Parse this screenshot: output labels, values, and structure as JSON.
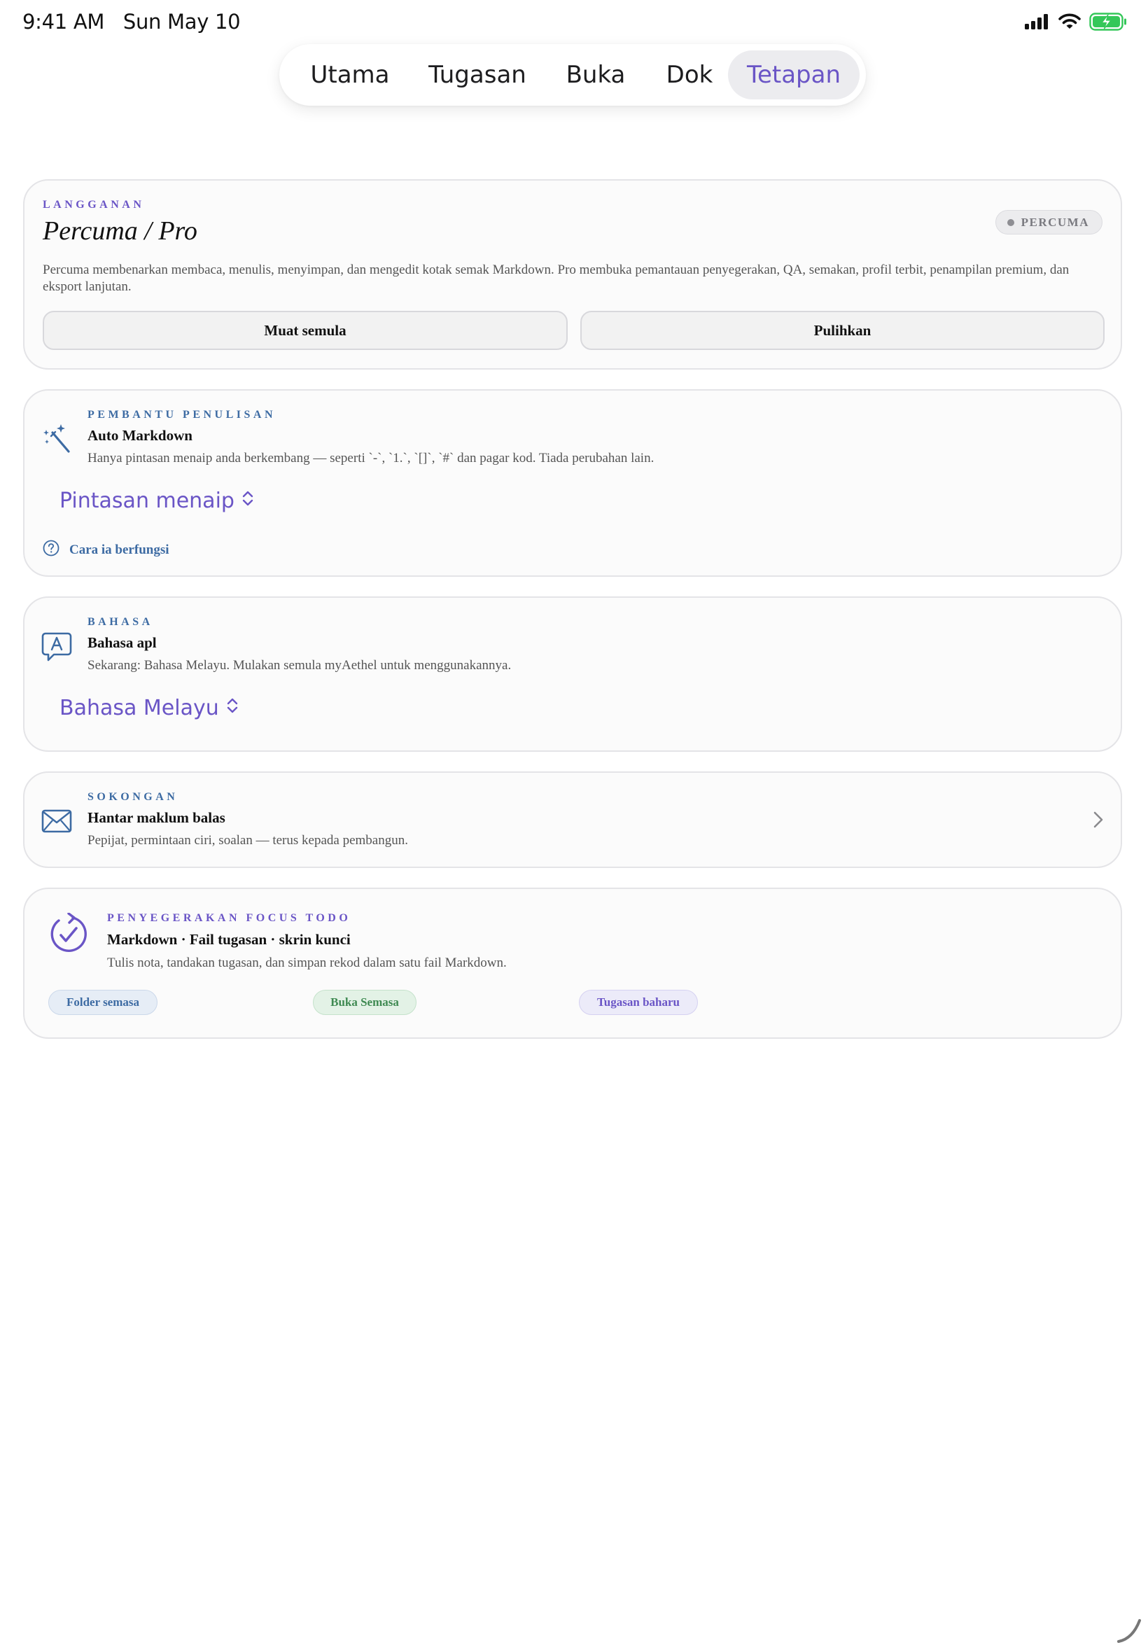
{
  "status_bar": {
    "time_date": "9:41 AM   Sun May 10",
    "icons": [
      "cellular-signal-icon",
      "wifi-icon",
      "battery-charging-icon"
    ]
  },
  "tabs": [
    {
      "label": "Utama",
      "active": false
    },
    {
      "label": "Tugasan",
      "active": false
    },
    {
      "label": "Buka",
      "active": false
    },
    {
      "label": "Dok",
      "active": false
    },
    {
      "label": "Tetapan",
      "active": true
    }
  ],
  "subscription": {
    "eyebrow": "LANGGANAN",
    "title": "Percuma / Pro",
    "badge": "PERCUMA",
    "description": "Percuma membenarkan membaca, menulis, menyimpan, dan mengedit kotak semak Markdown. Pro membuka pemantauan penyegerakan, QA, semakan, profil terbit, penampilan premium, dan eksport lanjutan.",
    "reload_label": "Muat semula",
    "restore_label": "Pulihkan"
  },
  "writing_assistant": {
    "icon": "magic-wand-icon",
    "eyebrow": "PEMBANTU PENULISAN",
    "title": "Auto Markdown",
    "description": "Hanya pintasan menaip anda berkembang — seperti `-`, `1.`, `[]`, `#` dan pagar kod. Tiada perubahan lain.",
    "picker_value": "Pintasan menaip",
    "help_label": "Cara ia berfungsi"
  },
  "language": {
    "icon": "translate-bubble-icon",
    "eyebrow": "BAHASA",
    "title": "Bahasa apl",
    "description": "Sekarang: Bahasa Melayu. Mulakan semula myAethel untuk menggunakannya.",
    "picker_value": "Bahasa Melayu"
  },
  "support": {
    "icon": "envelope-icon",
    "eyebrow": "SOKONGAN",
    "title": "Hantar maklum balas",
    "description": "Pepijat, permintaan ciri, soalan — terus kepada pembangun."
  },
  "sync": {
    "icon": "sync-check-icon",
    "eyebrow": "PENYEGERAKAN FOCUS TODO",
    "title": "Markdown · Fail tugasan · skrin kunci",
    "description": "Tulis nota, tandakan tugasan, dan simpan rekod dalam satu fail Markdown.",
    "chips": [
      "Folder semasa",
      "Buka Semasa",
      "Tugasan baharu"
    ]
  },
  "colors": {
    "accent_purple": "#6a55c6",
    "accent_blue": "#3d6ba3",
    "accent_green": "#3f8a52",
    "battery_green": "#34c759"
  }
}
